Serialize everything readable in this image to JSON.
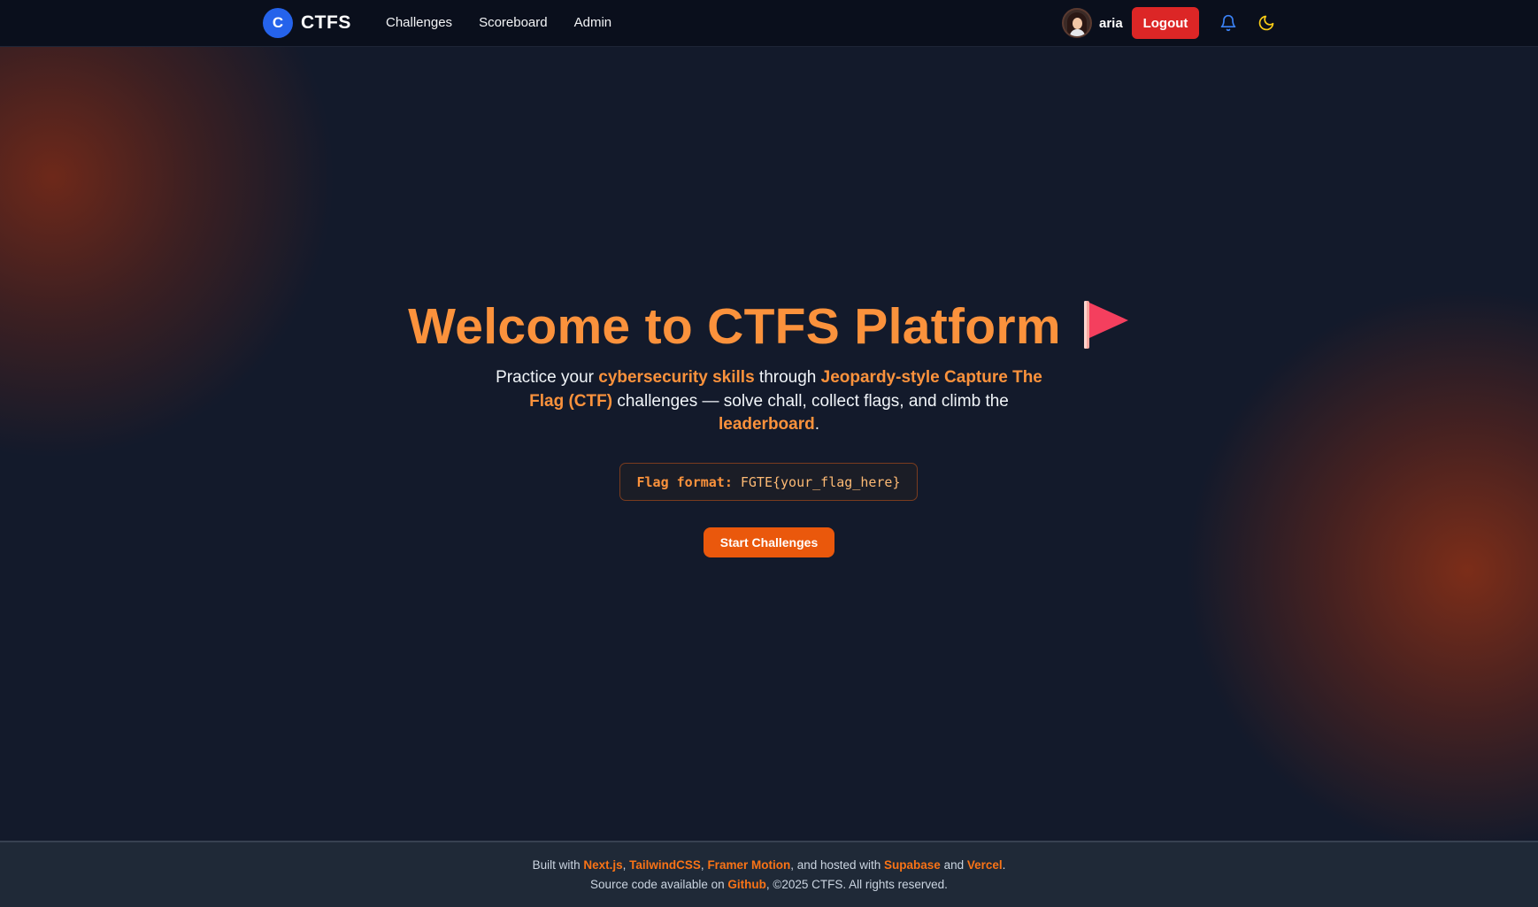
{
  "nav": {
    "logo_letter": "C",
    "brand": "CTFS",
    "links": [
      "Challenges",
      "Scoreboard",
      "Admin"
    ],
    "username": "aria",
    "logout_label": "Logout",
    "icons": {
      "notifications": "bell-icon",
      "theme_toggle": "moon-icon"
    }
  },
  "hero": {
    "title": "Welcome to CTFS Platform",
    "subtitle_parts": [
      {
        "text": "Practice your ",
        "highlight": false
      },
      {
        "text": "cybersecurity skills",
        "highlight": true
      },
      {
        "text": " through ",
        "highlight": false
      },
      {
        "text": "Jeopardy-style Capture The Flag (CTF)",
        "highlight": true
      },
      {
        "text": " challenges — solve chall, collect flags, and climb the ",
        "highlight": false
      },
      {
        "text": "leaderboard",
        "highlight": true
      },
      {
        "text": ".",
        "highlight": false
      }
    ],
    "flag_format_label": "Flag format:",
    "flag_format_value": "FGTE{your_flag_here}",
    "start_button": "Start Challenges",
    "flag_icon": "flag-icon"
  },
  "footer": {
    "line1": [
      {
        "text": "Built with ",
        "link": false
      },
      {
        "text": "Next.js",
        "link": true
      },
      {
        "text": ", ",
        "link": false
      },
      {
        "text": "TailwindCSS",
        "link": true
      },
      {
        "text": ", ",
        "link": false
      },
      {
        "text": "Framer Motion",
        "link": true
      },
      {
        "text": ", and hosted with ",
        "link": false
      },
      {
        "text": "Supabase",
        "link": true
      },
      {
        "text": " and ",
        "link": false
      },
      {
        "text": "Vercel",
        "link": true
      },
      {
        "text": ".",
        "link": false
      }
    ],
    "line2": [
      {
        "text": "Source code available on ",
        "link": false
      },
      {
        "text": "Github",
        "link": true
      },
      {
        "text": ", ©2025 CTFS. All rights reserved.",
        "link": false
      }
    ]
  },
  "colors": {
    "accent_orange": "#fb923c",
    "button_orange": "#ea580c",
    "logout_red": "#dc2626",
    "logo_blue": "#2563eb",
    "background": "#131a2b",
    "navbar": "#0a0f1c",
    "footer": "#1f2937"
  }
}
